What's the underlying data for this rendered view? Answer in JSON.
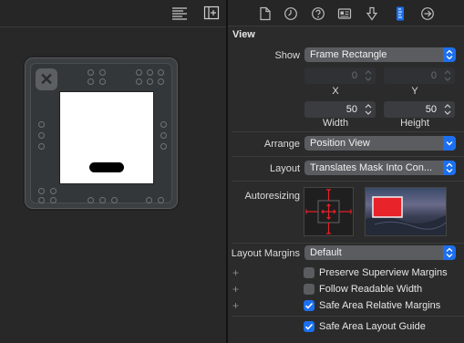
{
  "inspector": {
    "section_title": "View",
    "show": {
      "label": "Show",
      "value": "Frame Rectangle"
    },
    "x": {
      "value": "0",
      "label": "X"
    },
    "y": {
      "value": "0",
      "label": "Y"
    },
    "width": {
      "value": "50",
      "label": "Width"
    },
    "height": {
      "value": "50",
      "label": "Height"
    },
    "arrange": {
      "label": "Arrange",
      "value": "Position View"
    },
    "layout": {
      "label": "Layout",
      "value": "Translates Mask Into Con..."
    },
    "autoresizing": {
      "label": "Autoresizing"
    },
    "layout_margins": {
      "label": "Layout Margins",
      "value": "Default"
    },
    "checkboxes": [
      {
        "label": "Preserve Superview Margins",
        "checked": false,
        "plus": "+"
      },
      {
        "label": "Follow Readable Width",
        "checked": false,
        "plus": "+"
      },
      {
        "label": "Safe Area Relative Margins",
        "checked": true,
        "plus": "+"
      },
      {
        "label": "Safe Area Layout Guide",
        "checked": true,
        "plus": ""
      }
    ]
  },
  "canvas": {
    "close_symbol": "✕"
  },
  "colors": {
    "accent": "#1b6ff0",
    "autoresize_red": "#e8232a",
    "selected_tab": "#1b6ff0"
  }
}
